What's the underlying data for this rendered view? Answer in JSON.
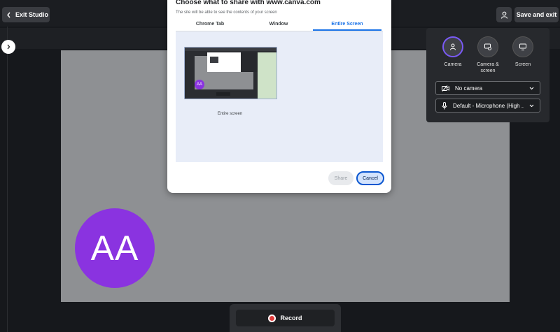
{
  "topbar": {
    "exit_label": "Exit Studio",
    "save_label": "Save and exit"
  },
  "stage": {
    "avatar_initials": "AA"
  },
  "record": {
    "label": "Record"
  },
  "panel": {
    "sources": [
      {
        "label": "Camera",
        "icon": "person-icon",
        "active": true
      },
      {
        "label": "Camera & screen",
        "icon": "camera-screen-icon",
        "active": false
      },
      {
        "label": "Screen",
        "icon": "monitor-icon",
        "active": false
      }
    ],
    "camera_select": "No camera",
    "mic_select": "Default - Microphone (High ..."
  },
  "share_dialog": {
    "title": "Choose what to share with www.canva.com",
    "subtitle": "The site will be able to see the contents of your screen",
    "tabs": [
      "Chrome Tab",
      "Window",
      "Entire Screen"
    ],
    "active_tab": "Entire Screen",
    "thumbnail_label": "Entire screen",
    "thumbnail_avatar": "AA",
    "share_label": "Share",
    "cancel_label": "Cancel"
  },
  "colors": {
    "accent": "#8a33e0",
    "link": "#1a73e8",
    "record": "#e03a3a"
  }
}
